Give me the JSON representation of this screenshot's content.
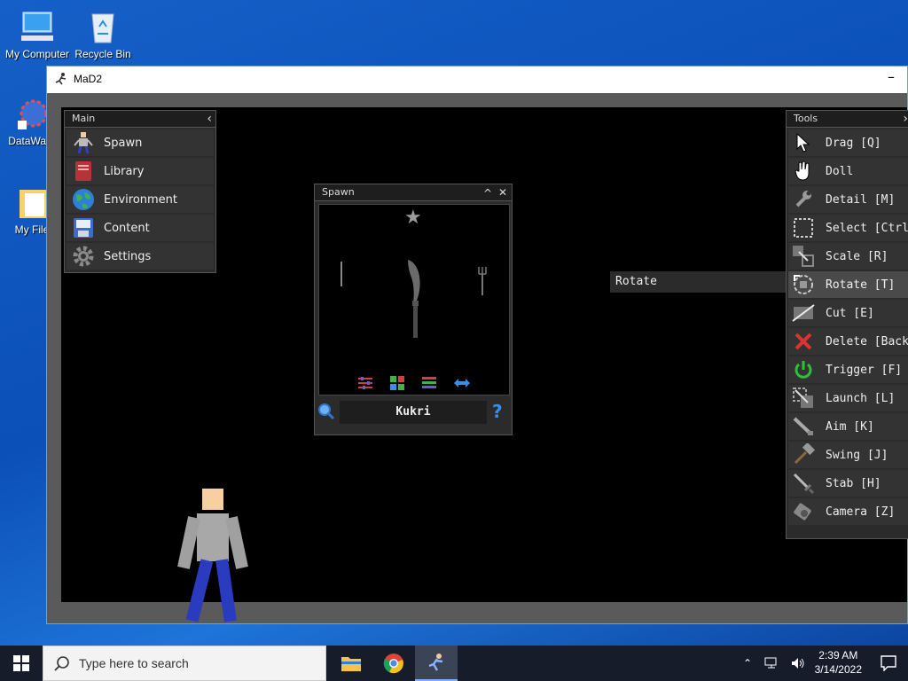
{
  "desktop": {
    "icons": [
      {
        "label": "My Computer"
      },
      {
        "label": "Recycle Bin"
      },
      {
        "label": "DataWag"
      },
      {
        "label": "My File"
      }
    ]
  },
  "window": {
    "title": "MaD2",
    "minimize_glyph": "–"
  },
  "main_panel": {
    "title": "Main",
    "collapse_glyph": "‹",
    "items": [
      {
        "label": "Spawn",
        "icon": "ragdoll-icon"
      },
      {
        "label": "Library",
        "icon": "book-icon"
      },
      {
        "label": "Environment",
        "icon": "globe-icon"
      },
      {
        "label": "Content",
        "icon": "floppy-disk-icon"
      },
      {
        "label": "Settings",
        "icon": "gear-icon"
      }
    ]
  },
  "spawn_panel": {
    "title": "Spawn",
    "collapse_glyph": "^",
    "close_glyph": "✕",
    "search_value": "Kukri",
    "help_glyph": "?"
  },
  "tooltip": {
    "text": "Rotate"
  },
  "tools_panel": {
    "title": "Tools",
    "items": [
      {
        "label": "Drag [Q]",
        "icon": "cursor-icon"
      },
      {
        "label": "Doll",
        "icon": "hand-icon"
      },
      {
        "label": "Detail [M]",
        "icon": "wrench-icon"
      },
      {
        "label": "Select [Ctrl",
        "icon": "selection-box-icon"
      },
      {
        "label": "Scale [R]",
        "icon": "scale-icon"
      },
      {
        "label": "Rotate [T]",
        "icon": "rotate-icon"
      },
      {
        "label": "Cut [E]",
        "icon": "cut-icon"
      },
      {
        "label": "Delete [Back",
        "icon": "delete-x-icon"
      },
      {
        "label": "Trigger [F]",
        "icon": "power-icon"
      },
      {
        "label": "Launch [L]",
        "icon": "launch-icon"
      },
      {
        "label": "Aim [K]",
        "icon": "aim-icon"
      },
      {
        "label": "Swing [J]",
        "icon": "hammer-icon"
      },
      {
        "label": "Stab [H]",
        "icon": "sword-icon"
      },
      {
        "label": "Camera [Z]",
        "icon": "camera-icon"
      }
    ],
    "active_index": 5
  },
  "taskbar": {
    "search_placeholder": "Type here to search",
    "time": "2:39 AM",
    "date": "3/14/2022"
  },
  "colors": {
    "panel_bg": "#2b2b2b",
    "game_bg": "#000000",
    "delete_red": "#e03030",
    "trigger_green": "#2fbf3a",
    "accent_blue": "#3a8ee6"
  }
}
